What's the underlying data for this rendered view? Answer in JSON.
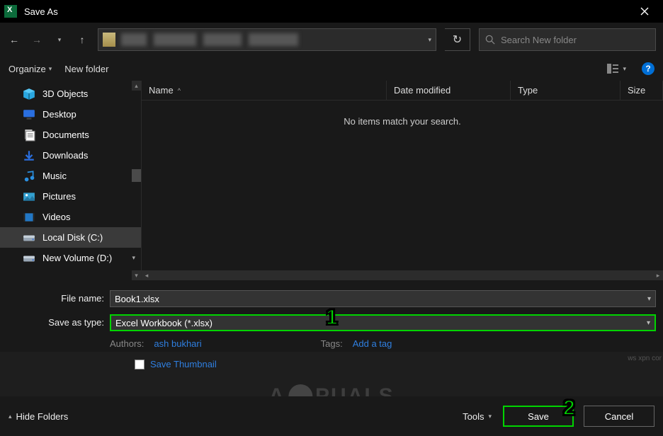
{
  "title": "Save As",
  "search": {
    "placeholder": "Search New folder"
  },
  "toolbar": {
    "organize": "Organize",
    "newfolder": "New folder"
  },
  "tree": {
    "items": [
      {
        "label": "3D Objects"
      },
      {
        "label": "Desktop"
      },
      {
        "label": "Documents"
      },
      {
        "label": "Downloads"
      },
      {
        "label": "Music"
      },
      {
        "label": "Pictures"
      },
      {
        "label": "Videos"
      },
      {
        "label": "Local Disk (C:)"
      },
      {
        "label": "New Volume (D:)"
      }
    ]
  },
  "columns": {
    "name": "Name",
    "date": "Date modified",
    "type": "Type",
    "size": "Size"
  },
  "empty": "No items match your search.",
  "form": {
    "filename_label": "File name:",
    "filename_value": "Book1.xlsx",
    "type_label": "Save as type:",
    "type_value": "Excel Workbook (*.xlsx)",
    "authors_label": "Authors:",
    "authors_value": "ash bukhari",
    "tags_label": "Tags:",
    "tags_value": "Add a tag",
    "thumbnail_label": "Save Thumbnail"
  },
  "bottom": {
    "hide": "Hide Folders",
    "tools": "Tools",
    "save": "Save",
    "cancel": "Cancel"
  },
  "watermark": "A  PUALS",
  "callouts": {
    "one": "1",
    "two": "2"
  },
  "corner": "ws xpn cor"
}
